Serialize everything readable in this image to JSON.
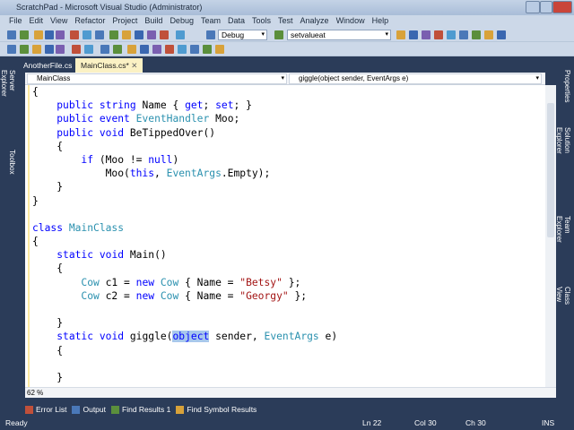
{
  "window": {
    "title": "ScratchPad - Microsoft Visual Studio (Administrator)"
  },
  "menu": [
    "File",
    "Edit",
    "View",
    "Refactor",
    "Project",
    "Build",
    "Debug",
    "Team",
    "Data",
    "Tools",
    "Test",
    "Analyze",
    "Window",
    "Help"
  ],
  "toolbar": {
    "config": "Debug",
    "find": "setvalueat"
  },
  "tabs": [
    {
      "label": "AnotherFile.cs"
    },
    {
      "label": "MainClass.cs*"
    }
  ],
  "nav": {
    "class": "MainClass",
    "member": "giggle(object sender, EventArgs e)"
  },
  "left_panels": [
    "Server Explorer",
    "Toolbox"
  ],
  "right_panels": [
    "Properties",
    "Solution Explorer",
    "Team Explorer",
    "Class View"
  ],
  "code": [
    [
      [
        "",
        "{"
      ]
    ],
    [
      [
        "",
        "    "
      ],
      [
        "kw",
        "public"
      ],
      [
        "",
        " "
      ],
      [
        "kw",
        "string"
      ],
      [
        "",
        " Name { "
      ],
      [
        "kw",
        "get"
      ],
      [
        "",
        "; "
      ],
      [
        "kw",
        "set"
      ],
      [
        "",
        "; }"
      ]
    ],
    [
      [
        "",
        "    "
      ],
      [
        "kw",
        "public"
      ],
      [
        "",
        " "
      ],
      [
        "kw",
        "event"
      ],
      [
        "",
        " "
      ],
      [
        "ty",
        "EventHandler"
      ],
      [
        "",
        " Moo;"
      ]
    ],
    [
      [
        "",
        "    "
      ],
      [
        "kw",
        "public"
      ],
      [
        "",
        " "
      ],
      [
        "kw",
        "void"
      ],
      [
        "",
        " BeTippedOver()"
      ]
    ],
    [
      [
        "",
        "    {"
      ]
    ],
    [
      [
        "",
        "        "
      ],
      [
        "kw",
        "if"
      ],
      [
        "",
        " (Moo != "
      ],
      [
        "kw",
        "null"
      ],
      [
        "",
        ")"
      ]
    ],
    [
      [
        "",
        "            Moo("
      ],
      [
        "kw",
        "this"
      ],
      [
        "",
        ", "
      ],
      [
        "ty",
        "EventArgs"
      ],
      [
        "",
        ".Empty);"
      ]
    ],
    [
      [
        "",
        "    }"
      ]
    ],
    [
      [
        "",
        "}"
      ]
    ],
    [
      [
        "",
        ""
      ]
    ],
    [
      [
        "kw",
        "class"
      ],
      [
        "",
        " "
      ],
      [
        "ty",
        "MainClass"
      ]
    ],
    [
      [
        "",
        "{"
      ]
    ],
    [
      [
        "",
        "    "
      ],
      [
        "kw",
        "static"
      ],
      [
        "",
        " "
      ],
      [
        "kw",
        "void"
      ],
      [
        "",
        " Main()"
      ]
    ],
    [
      [
        "",
        "    {"
      ]
    ],
    [
      [
        "",
        "        "
      ],
      [
        "ty",
        "Cow"
      ],
      [
        "",
        " c1 = "
      ],
      [
        "kw",
        "new"
      ],
      [
        "",
        " "
      ],
      [
        "ty",
        "Cow"
      ],
      [
        "",
        " { Name = "
      ],
      [
        "st",
        "\"Betsy\""
      ],
      [
        "",
        " };"
      ]
    ],
    [
      [
        "",
        "        "
      ],
      [
        "ty",
        "Cow"
      ],
      [
        "",
        " c2 = "
      ],
      [
        "kw",
        "new"
      ],
      [
        "",
        " "
      ],
      [
        "ty",
        "Cow"
      ],
      [
        "",
        " { Name = "
      ],
      [
        "st",
        "\"Georgy\""
      ],
      [
        "",
        " };"
      ]
    ],
    [
      [
        "",
        ""
      ]
    ],
    [
      [
        "",
        "    }"
      ]
    ],
    [
      [
        "",
        "    "
      ],
      [
        "kw",
        "static"
      ],
      [
        "",
        " "
      ],
      [
        "kw",
        "void"
      ],
      [
        "",
        " giggle("
      ],
      [
        "kw sel",
        "object"
      ],
      [
        "",
        " sender, "
      ],
      [
        "ty",
        "EventArgs"
      ],
      [
        "",
        " e)"
      ]
    ],
    [
      [
        "",
        "    {"
      ]
    ],
    [
      [
        "",
        ""
      ]
    ],
    [
      [
        "",
        "    }"
      ]
    ]
  ],
  "zoom": "62 %",
  "bottom_tabs": [
    "Error List",
    "Output",
    "Find Results 1",
    "Find Symbol Results"
  ],
  "status": {
    "ready": "Ready",
    "ln": "Ln 22",
    "col": "Col 30",
    "ch": "Ch 30",
    "mode": "INS"
  }
}
